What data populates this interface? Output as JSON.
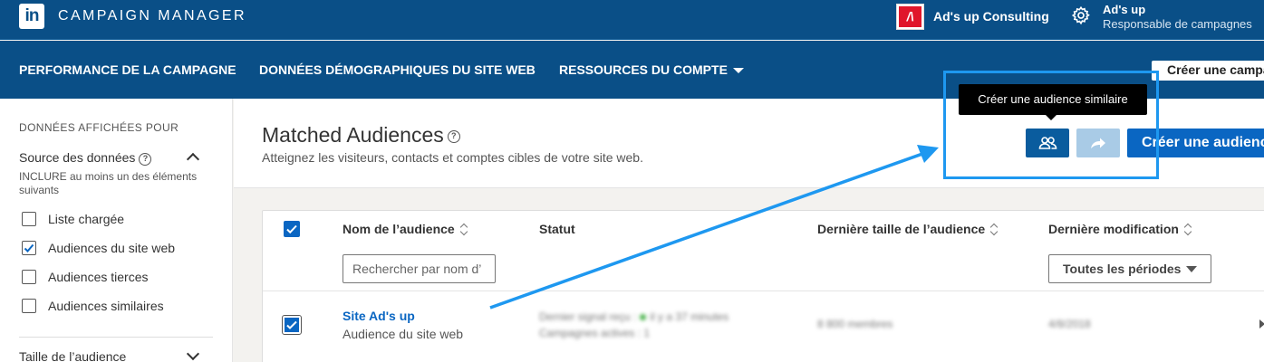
{
  "topbar": {
    "logo_text": "in",
    "app_title": "CAMPAIGN MANAGER",
    "account_logo_text": "/\\",
    "account_name": "Ad's up Consulting",
    "user_name": "Ad's up",
    "user_role": "Responsable de campagnes"
  },
  "nav": {
    "items": [
      {
        "label": "PERFORMANCE DE LA CAMPAGNE"
      },
      {
        "label": "DONNÉES DÉMOGRAPHIQUES DU SITE WEB"
      },
      {
        "label": "RESSOURCES DU COMPTE"
      }
    ],
    "create_campaign": "Créer une campa"
  },
  "sidebar": {
    "heading": "DONNÉES AFFICHÉES POUR",
    "source_label": "Source des données",
    "include_text": "INCLURE au moins un des éléments suivants",
    "options": [
      {
        "label": "Liste chargée",
        "checked": false
      },
      {
        "label": "Audiences du site web",
        "checked": true
      },
      {
        "label": "Audiences tierces",
        "checked": false
      },
      {
        "label": "Audiences similaires",
        "checked": false
      }
    ],
    "size_label": "Taille de l’audience"
  },
  "header": {
    "title": "Matched Audiences",
    "subtitle": "Atteignez les visiteurs, contacts et comptes cibles de votre site web.",
    "create_button": "Créer une audienc",
    "tooltip": "Créer une audience similaire"
  },
  "table": {
    "columns": {
      "name": "Nom de l’audience",
      "status": "Statut",
      "size": "Dernière taille de l’audience",
      "modified": "Dernière modification"
    },
    "search_placeholder": "Rechercher par nom d’",
    "period_select": "Toutes les périodes",
    "rows": [
      {
        "name": "Site Ad's up",
        "type": "Audience du site web",
        "status_line1": "Dernier signal reçu :",
        "status_time": "il y a 37 minutes",
        "status_line2": "Campagnes actives : 1",
        "size": "8 800 membres",
        "modified": "4/8/2018"
      }
    ]
  },
  "colors": {
    "brand_dark": "#0a4f87",
    "primary": "#0a66c2",
    "highlight": "#1e98f0"
  }
}
